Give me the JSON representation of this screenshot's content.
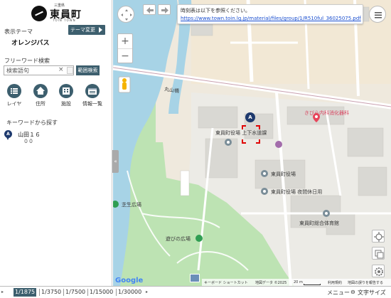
{
  "logo": {
    "subtitle": "三重県",
    "name": "東員町",
    "roman": "TOIN TOWN"
  },
  "sidebar": {
    "theme_label": "表示テーマ",
    "theme_value": "オレンジバス",
    "theme_button": "テーマ変更",
    "search_label": "フリーワード検索",
    "search_placeholder": "検索語句",
    "clear_symbol": "×",
    "range_button": "範囲検索",
    "menu": [
      {
        "label": "レイヤ",
        "icon": "layer-list-icon"
      },
      {
        "label": "住所",
        "icon": "house-icon"
      },
      {
        "label": "施設",
        "icon": "building-icon"
      },
      {
        "label": "情報一覧",
        "icon": "list-panel-icon"
      }
    ],
    "keyword_heading": "キーワードから探す",
    "keyword_item": {
      "marker": "A",
      "title": "山田１６",
      "sub": "００"
    },
    "collapse_symbol": "«"
  },
  "map": {
    "info": {
      "text": "時刻表は以下を参照ください。",
      "link": "https://www.town.toin.lg.jp/material/files/group/1/R510ful_36025075.pdf"
    },
    "labels": {
      "bridge": "丸山橋",
      "clinic": "きびら内科消化器科",
      "stop": "東員町役場 上下水道課",
      "town_hall": "東員町役場",
      "town_hall_night": "東員町役場 夜間休日用",
      "hall": "東員町総合体育館",
      "lawn": "芝生広場",
      "play": "遊びの広場"
    },
    "stop_marker": "A",
    "zoom_in": "+",
    "zoom_out": "−",
    "attribution": {
      "google": "Google",
      "shortcuts": "キーボード ショートカット",
      "map_data": "地図データ ©2025",
      "scale": "20 m",
      "terms": "利用規約",
      "report": "地図の誤りを報告する"
    },
    "colors": {
      "river": "#a7d3e6",
      "park": "#bde3b3",
      "road": "#ffffff",
      "building": "#d9d8d3",
      "accent": "#3d5f6e"
    }
  },
  "bottom": {
    "arrow": "▸",
    "scales": [
      "1/1875",
      "1/3750",
      "1/7500",
      "1/15000",
      "1/30000"
    ],
    "active_scale": "1/1875",
    "more": "▸",
    "menu": "メニュー",
    "font_size_icon": "⊖",
    "font_size": "文字サイズ"
  }
}
